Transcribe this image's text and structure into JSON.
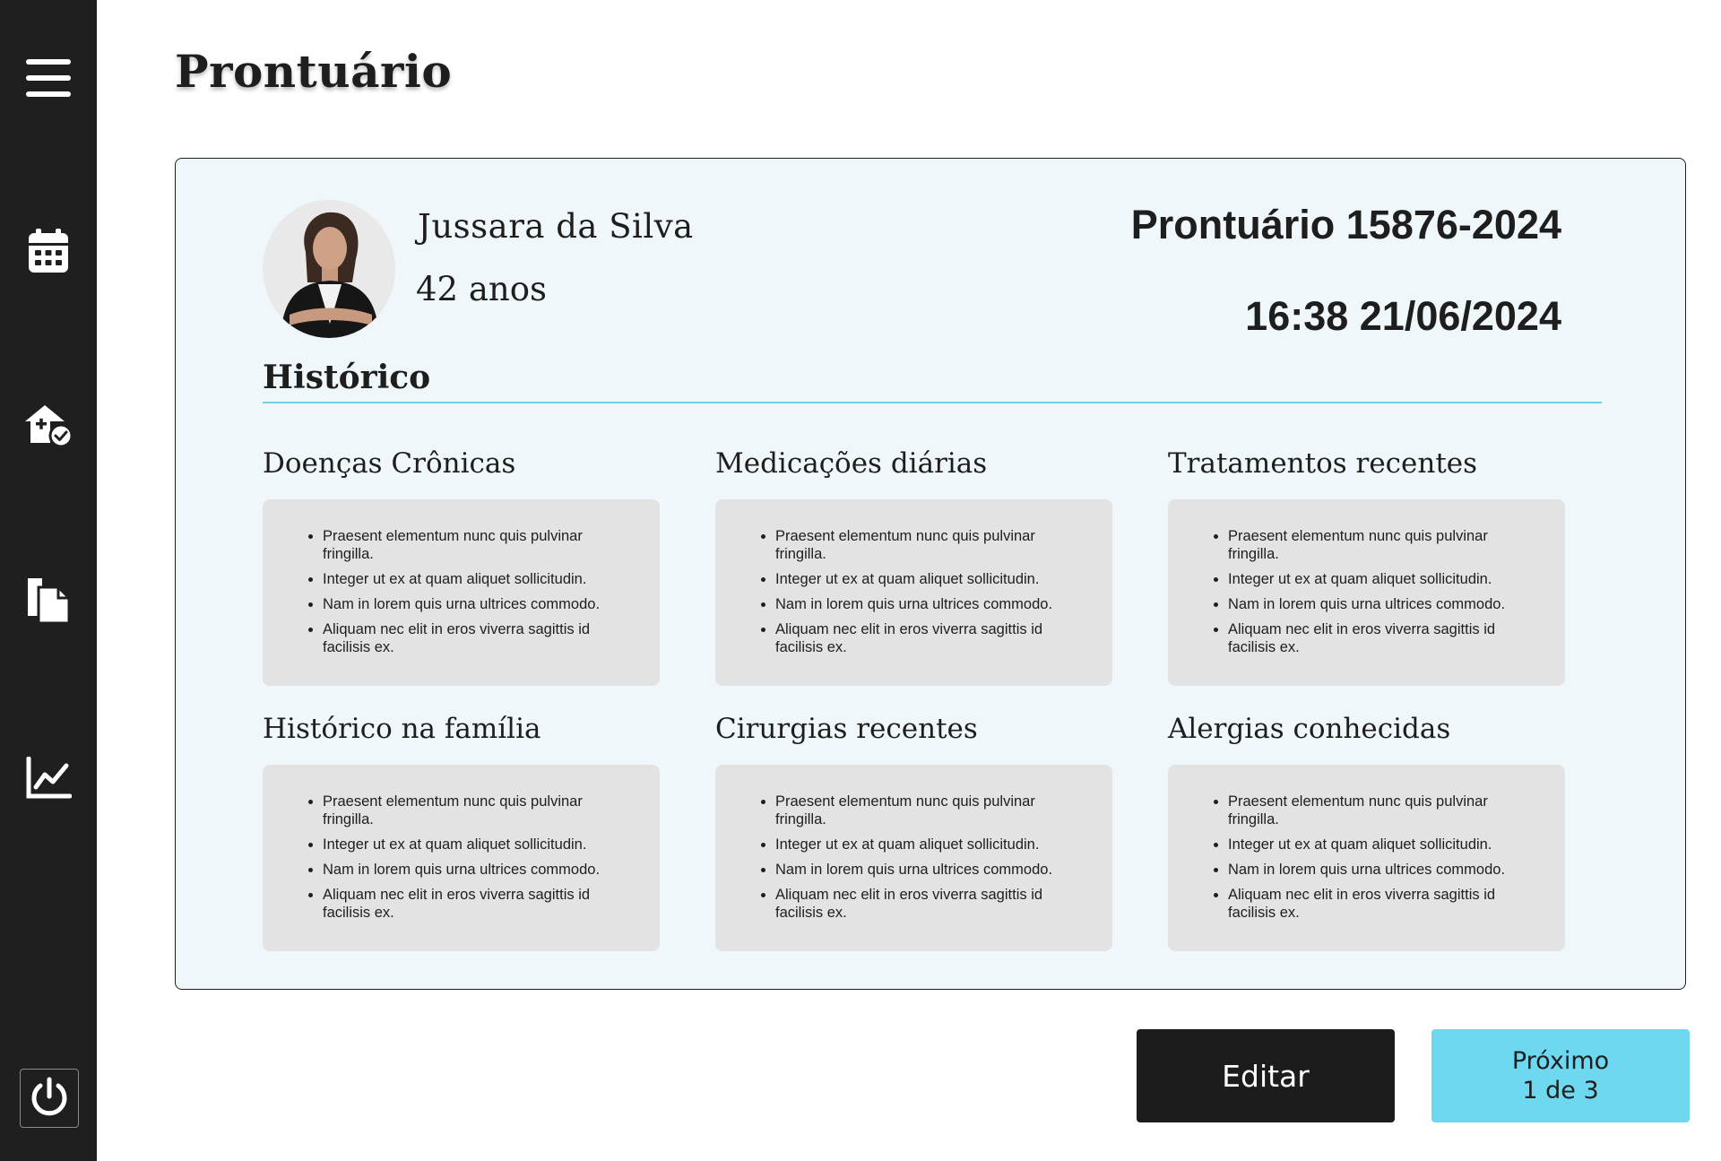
{
  "page": {
    "title": "Prontuário"
  },
  "sidebar": {
    "items": [
      {
        "icon": "menu-icon"
      },
      {
        "icon": "calendar-icon"
      },
      {
        "icon": "home-health-check-icon"
      },
      {
        "icon": "documents-icon"
      },
      {
        "icon": "chart-line-icon"
      }
    ],
    "power_icon": "power-icon"
  },
  "patient": {
    "name": "Jussara da Silva",
    "age": "42 anos",
    "record_id": "Prontuário 15876-2024",
    "datetime": "16:38 21/06/2024"
  },
  "history": {
    "title": "Histórico",
    "groups": [
      {
        "title": "Doenças Crônicas",
        "items": [
          "Praesent elementum nunc quis pulvinar fringilla.",
          "Integer ut ex at quam aliquet sollicitudin.",
          "Nam in lorem quis urna ultrices commodo.",
          "Aliquam nec elit in eros viverra sagittis id facilisis ex."
        ]
      },
      {
        "title": "Medicações diárias",
        "items": [
          "Praesent elementum nunc quis pulvinar fringilla.",
          "Integer ut ex at quam aliquet sollicitudin.",
          "Nam in lorem quis urna ultrices commodo.",
          "Aliquam nec elit in eros viverra sagittis id facilisis ex."
        ]
      },
      {
        "title": "Tratamentos recentes",
        "items": [
          "Praesent elementum nunc quis pulvinar fringilla.",
          "Integer ut ex at quam aliquet sollicitudin.",
          "Nam in lorem quis urna ultrices commodo.",
          "Aliquam nec elit in eros viverra sagittis id facilisis ex."
        ]
      },
      {
        "title": "Histórico na família",
        "items": [
          "Praesent elementum nunc quis pulvinar fringilla.",
          "Integer ut ex at quam aliquet sollicitudin.",
          "Nam in lorem quis urna ultrices commodo.",
          "Aliquam nec elit in eros viverra sagittis id facilisis ex."
        ]
      },
      {
        "title": "Cirurgias recentes",
        "items": [
          "Praesent elementum nunc quis pulvinar fringilla.",
          "Integer ut ex at quam aliquet sollicitudin.",
          "Nam in lorem quis urna ultrices commodo.",
          "Aliquam nec elit in eros viverra sagittis id facilisis ex."
        ]
      },
      {
        "title": "Alergias conhecidas",
        "items": [
          "Praesent elementum nunc quis pulvinar fringilla.",
          "Integer ut ex at quam aliquet sollicitudin.",
          "Nam in lorem quis urna ultrices commodo.",
          "Aliquam nec elit in eros viverra sagittis id facilisis ex."
        ]
      }
    ]
  },
  "actions": {
    "edit_label": "Editar",
    "next_label": "Próximo",
    "next_pagination": "1 de 3"
  },
  "colors": {
    "sidebar_bg": "#1f1f1f",
    "accent": "#6dd8f0",
    "card_bg": "#f0f7fb",
    "group_bg": "#e3e3e3",
    "text": "#1e1e1e"
  }
}
